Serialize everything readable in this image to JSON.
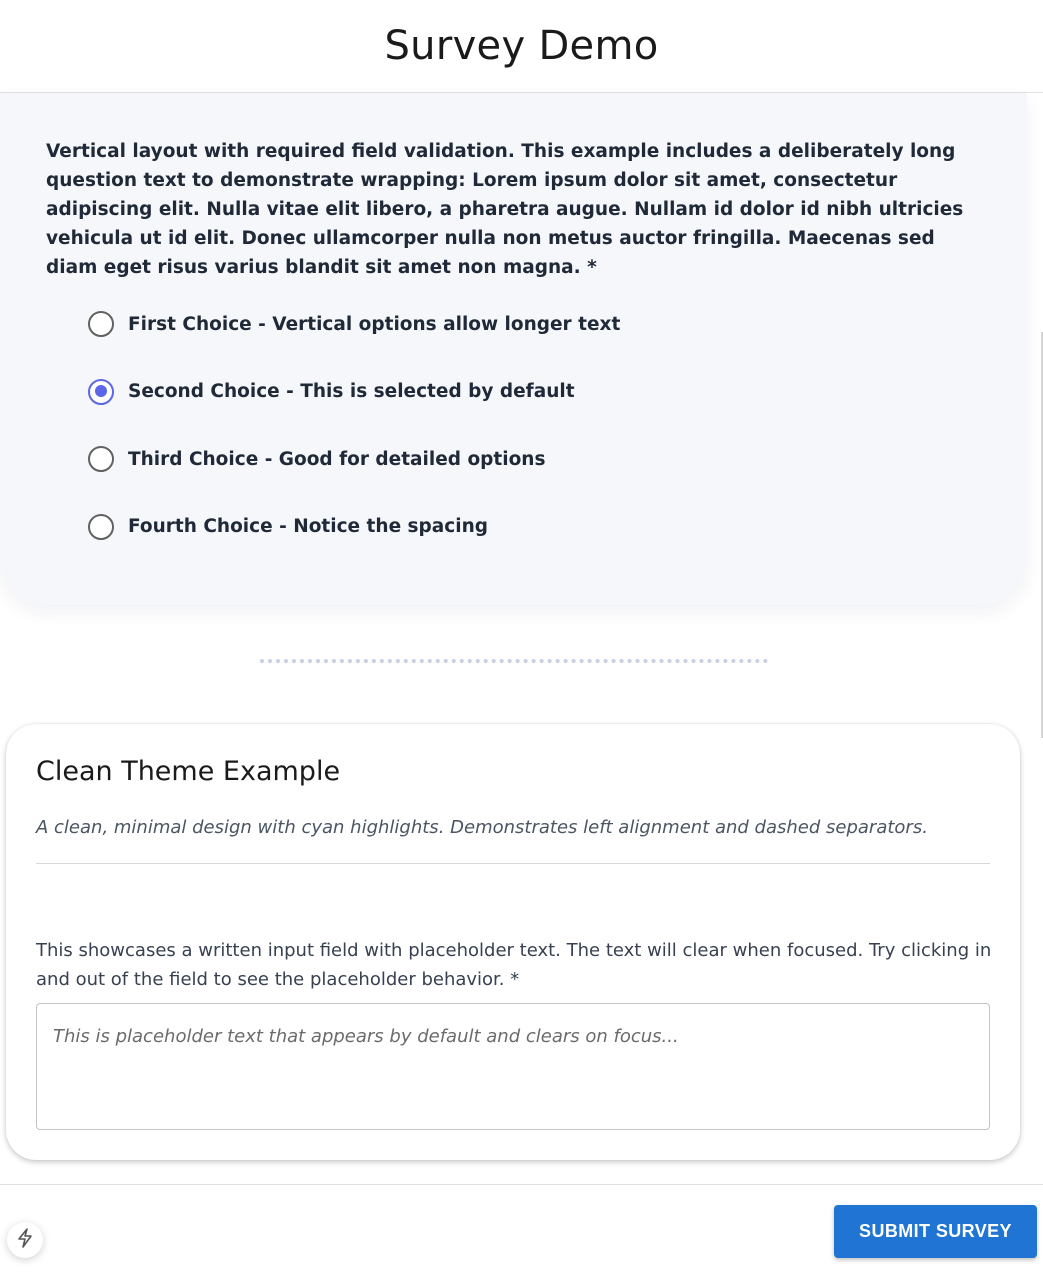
{
  "header": {
    "title": "Survey Demo"
  },
  "question1": {
    "text": "Vertical layout with required field validation. This example includes a deliberately long question text to demonstrate wrapping: Lorem ipsum dolor sit amet, consectetur adipiscing elit. Nulla vitae elit libero, a pharetra augue. Nullam id dolor id nibh ultricies vehicula ut id elit. Donec ullamcorper nulla non metus auctor fringilla. Maecenas sed diam eget risus varius blandit sit amet non magna. *",
    "options": [
      {
        "label": "First Choice - Vertical options allow longer text",
        "selected": false
      },
      {
        "label": "Second Choice - This is selected by default",
        "selected": true
      },
      {
        "label": "Third Choice - Good for detailed options",
        "selected": false
      },
      {
        "label": "Fourth Choice - Notice the spacing",
        "selected": false
      }
    ]
  },
  "section2": {
    "title": "Clean Theme Example",
    "description": "A clean, minimal design with cyan highlights. Demonstrates left alignment and dashed separators.",
    "question": "This showcases a written input field with placeholder text. The text will clear when focused. Try clicking in and out of the field to see the placeholder behavior. *",
    "input_value": "",
    "input_placeholder": "This is placeholder text that appears by default and clears on focus..."
  },
  "footer": {
    "submit_label": "SUBMIT SURVEY"
  },
  "colors": {
    "radio_accent": "#5b66e8",
    "submit_button": "#1f74d4",
    "card_background": "#f6f7fb"
  },
  "icons": {
    "floating_button": "lightning-bolt-icon"
  }
}
